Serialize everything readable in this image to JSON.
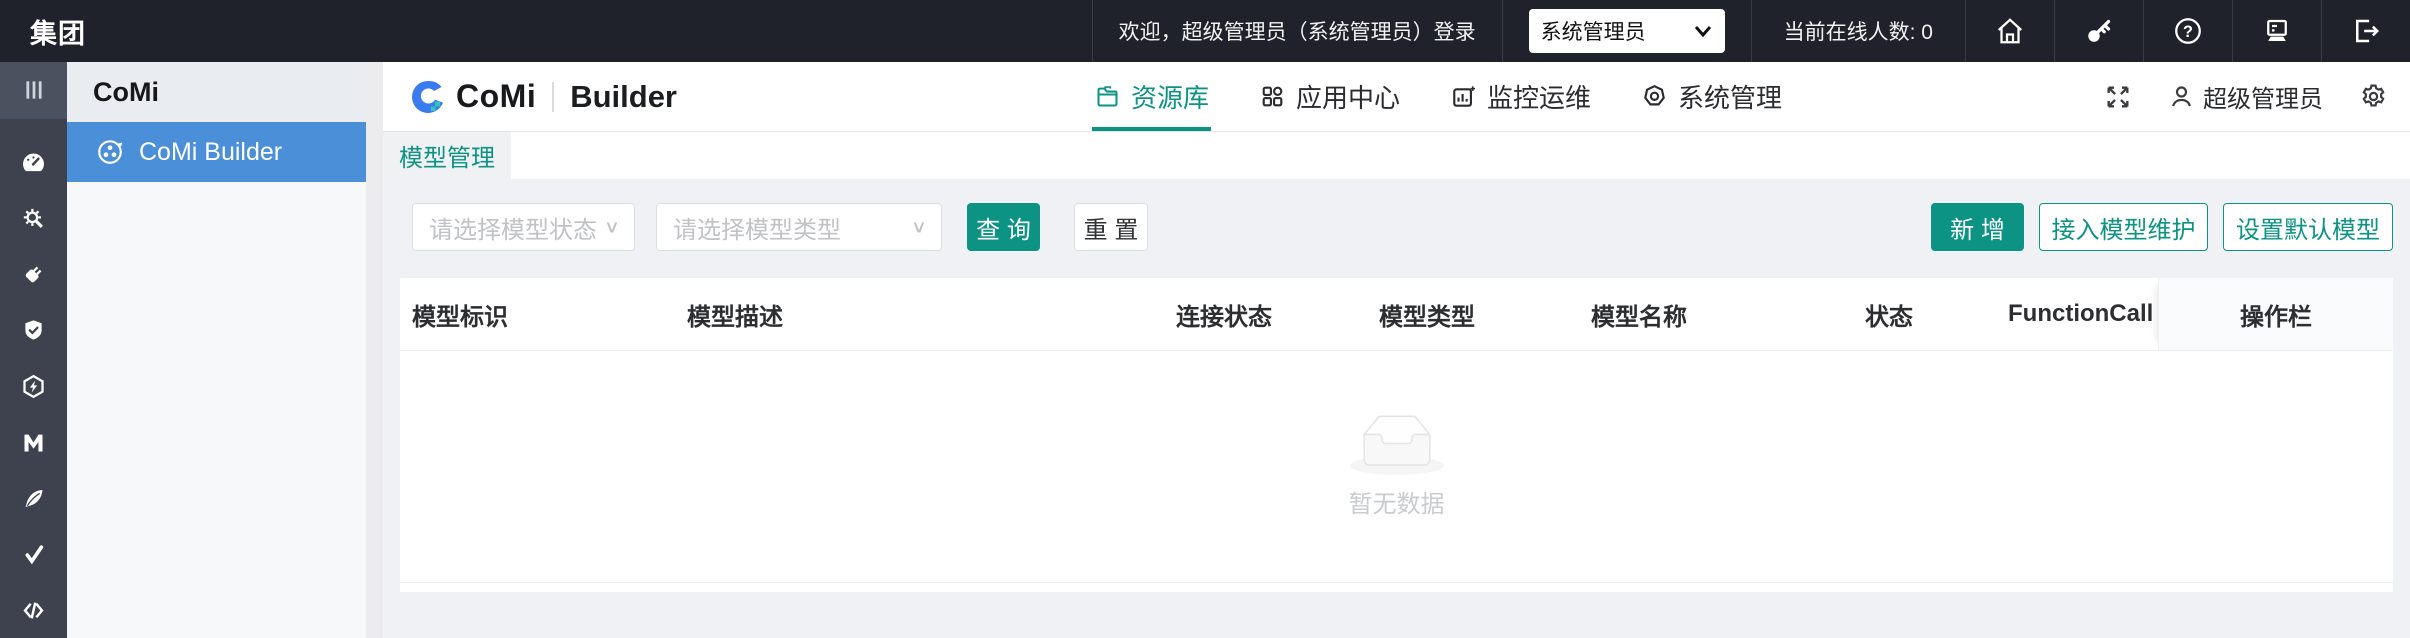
{
  "colors": {
    "accent": "#0c9384",
    "selected_blue": "#4a8fd7",
    "topbar_bg": "#20222b",
    "rail_bg": "#3d424e"
  },
  "topbar": {
    "brand": "集团",
    "welcome": "欢迎，超级管理员（系统管理员）登录",
    "role_select_value": "系统管理员",
    "online_label": "当前在线人数: 0",
    "icons": [
      "home-icon",
      "key-icon",
      "help-icon",
      "workstation-icon",
      "logout-icon"
    ]
  },
  "rail": {
    "icons": [
      "collapse-icon",
      "dashboard-icon",
      "settings-search-icon",
      "plug-icon",
      "shield-check-icon",
      "hexagon-bolt-icon",
      "m-letter-icon",
      "feather-icon",
      "check-icon",
      "code-icon"
    ]
  },
  "sidebar": {
    "title": "CoMi",
    "items": [
      {
        "label": "CoMi Builder",
        "selected": true
      }
    ]
  },
  "appbar": {
    "logo_brand": "CoMi",
    "logo_product": "Builder",
    "nav": [
      {
        "label": "资源库",
        "active": true
      },
      {
        "label": "应用中心",
        "active": false
      },
      {
        "label": "监控运维",
        "active": false
      },
      {
        "label": "系统管理",
        "active": false
      }
    ],
    "user_name": "超级管理员"
  },
  "tabbar": {
    "tabs": [
      {
        "label": "模型管理",
        "active": true
      }
    ]
  },
  "filters": {
    "status_placeholder": "请选择模型状态",
    "type_placeholder": "请选择模型类型",
    "search_label": "查 询",
    "reset_label": "重 置",
    "add_label": "新 增",
    "maintain_label": "接入模型维护",
    "default_label": "设置默认模型"
  },
  "table": {
    "columns": [
      "模型标识",
      "模型描述",
      "连接状态",
      "模型类型",
      "模型名称",
      "状态",
      "FunctionCall",
      "操作栏"
    ],
    "rows": [],
    "empty_text": "暂无数据"
  }
}
